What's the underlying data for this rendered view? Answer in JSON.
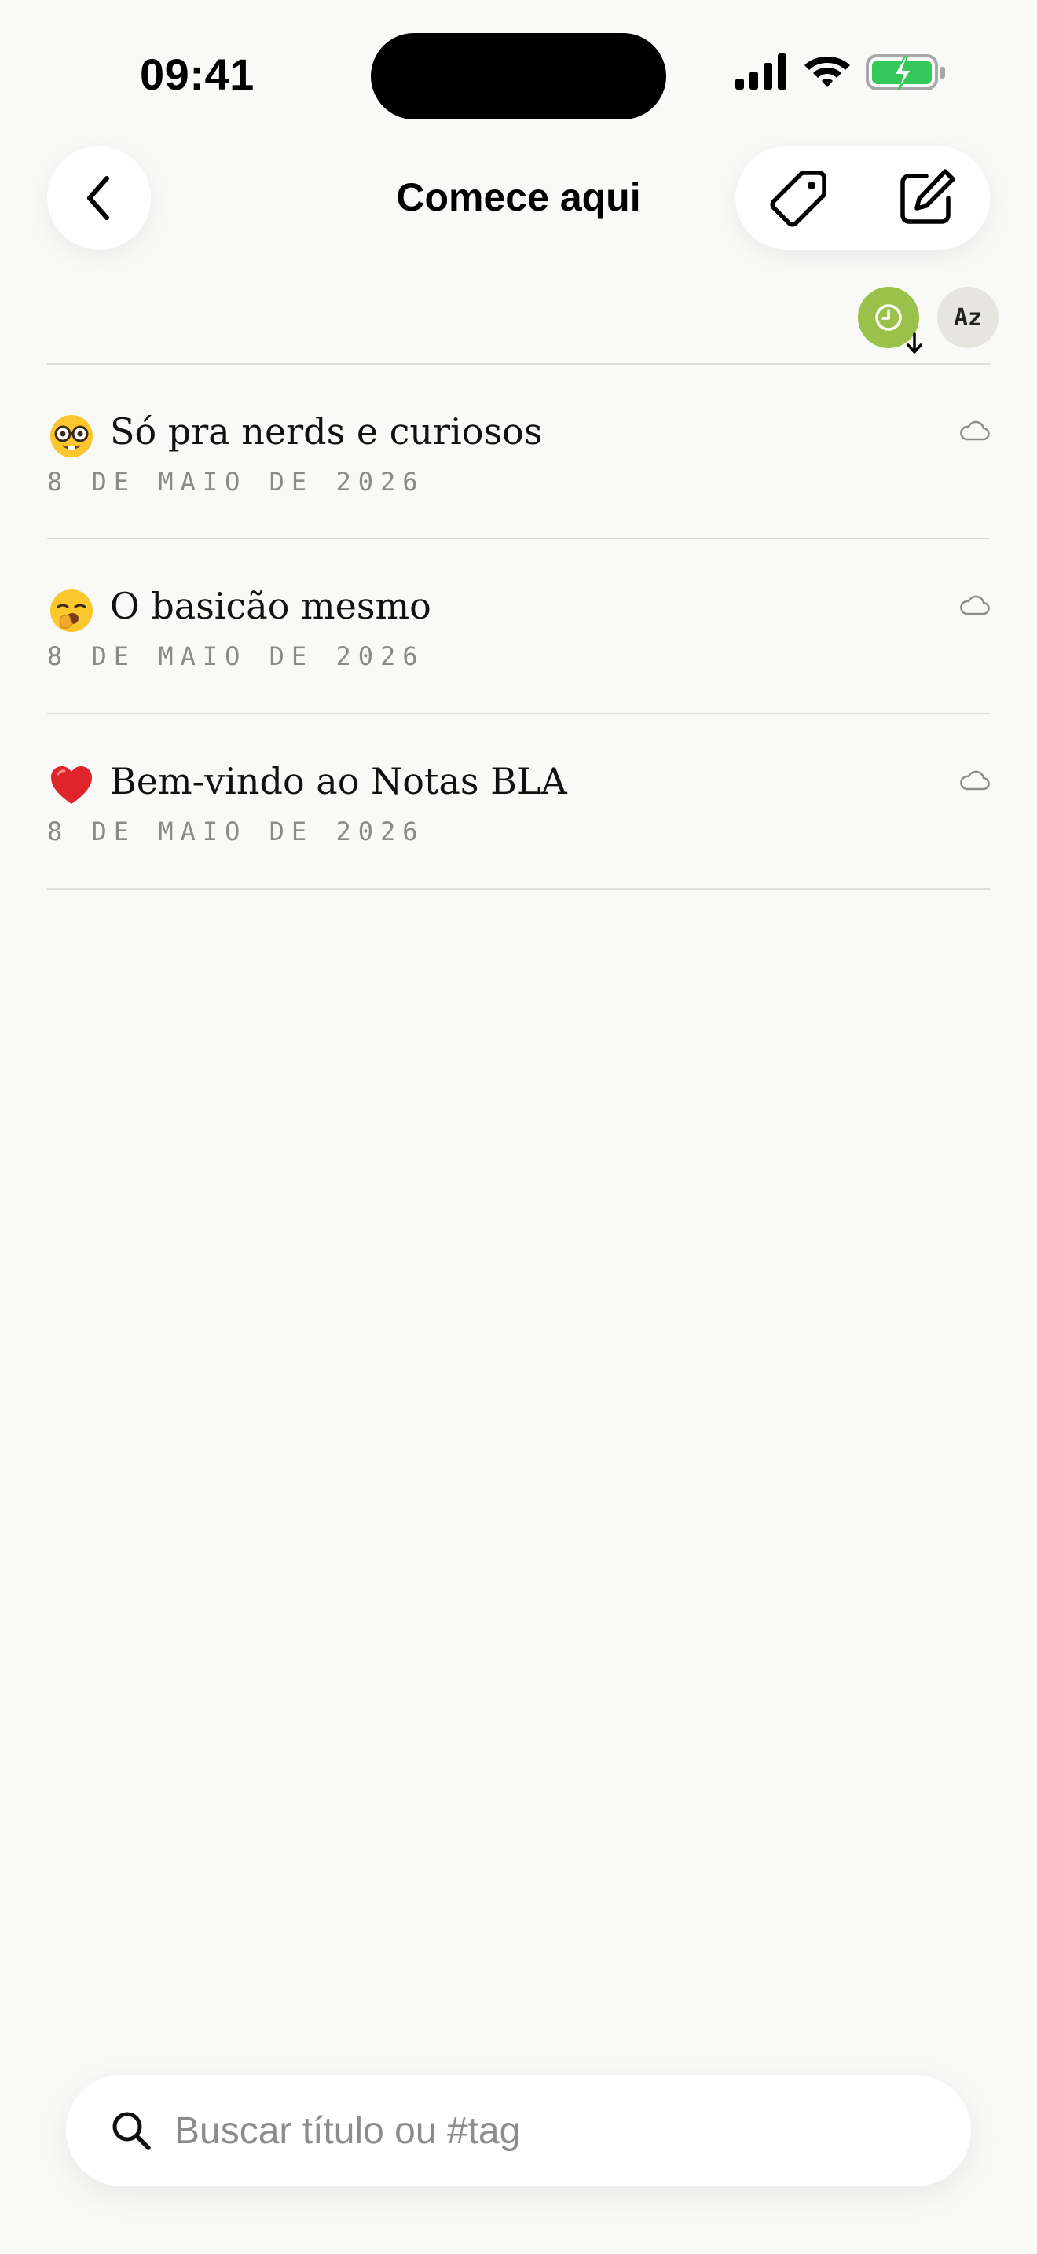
{
  "status_bar": {
    "time": "09:41",
    "icons": [
      "cellular-signal-icon",
      "wifi-icon",
      "battery-charging-icon"
    ],
    "battery_color": "#34c759"
  },
  "header": {
    "title": "Comece aqui",
    "back_icon": "chevron-left-icon",
    "actions": [
      "tag-icon",
      "compose-icon"
    ]
  },
  "sort": {
    "date_icon": "clock-icon",
    "direction_icon": "arrow-down-icon",
    "date_active_color": "#9ac24a",
    "alpha_label": "Az"
  },
  "notes": [
    {
      "emoji": "nerd-face",
      "title": "Só pra nerds e curiosos",
      "date": "8 DE MAIO DE 2026",
      "sync_icon": "cloud-icon"
    },
    {
      "emoji": "yawning-face",
      "title": "O basicão mesmo",
      "date": "8 DE MAIO DE 2026",
      "sync_icon": "cloud-icon"
    },
    {
      "emoji": "red-heart",
      "title": "Bem-vindo ao Notas BLA",
      "date": "8 DE MAIO DE 2026",
      "sync_icon": "cloud-icon"
    }
  ],
  "search": {
    "placeholder": "Buscar título ou #tag",
    "value": ""
  }
}
